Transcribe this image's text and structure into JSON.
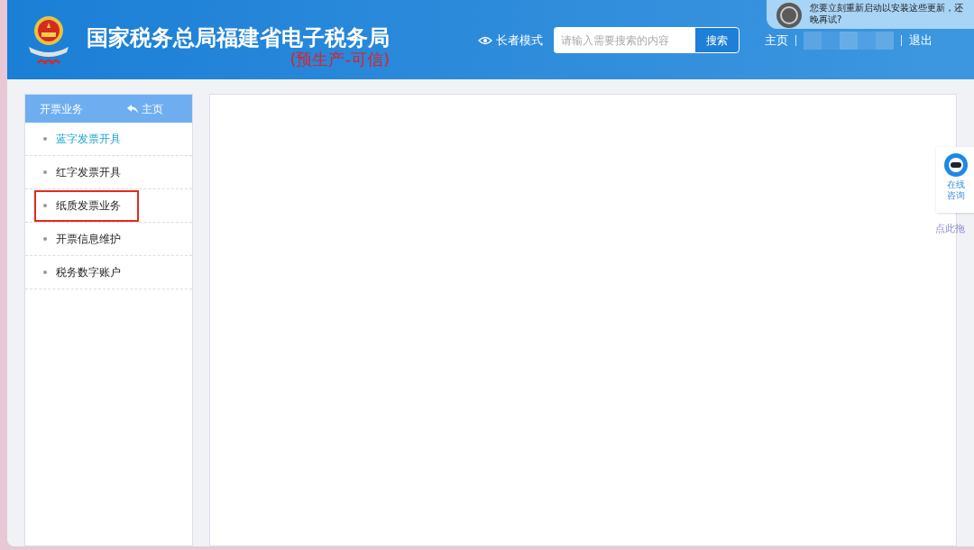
{
  "header": {
    "title": "国家税务总局福建省电子税务局",
    "subtitle": "(预生产-可信)",
    "elder_mode": "长者模式",
    "search": {
      "placeholder": "请输入需要搜索的内容",
      "button": "搜索"
    },
    "home_link": "主页",
    "logout": "退出"
  },
  "notification": {
    "lines": [
      "您要立刻重新启动以安装这些更新，还",
      "晚再试?"
    ]
  },
  "sidebar": {
    "title": "开票业务",
    "home": "主页",
    "items": [
      {
        "label": "蓝字发票开具",
        "selected": true,
        "highlighted": false
      },
      {
        "label": "红字发票开具",
        "selected": false,
        "highlighted": false
      },
      {
        "label": "纸质发票业务",
        "selected": false,
        "highlighted": true
      },
      {
        "label": "开票信息维护",
        "selected": false,
        "highlighted": false
      },
      {
        "label": "税务数字账户",
        "selected": false,
        "highlighted": false
      }
    ]
  },
  "consult_widget": {
    "label": "在线咨询",
    "drag_hint": "点此拖"
  }
}
